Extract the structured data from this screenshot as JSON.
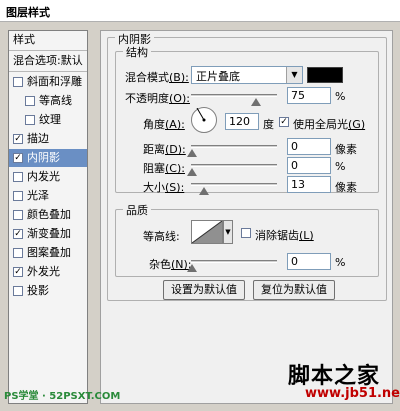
{
  "window": {
    "title": "图层样式"
  },
  "style_list": {
    "header_label": "样式",
    "blend_options_label": "混合选项:默认",
    "items": [
      {
        "label": "斜面和浮雕",
        "checked": false,
        "indent": false,
        "selected": false
      },
      {
        "label": "等高线",
        "checked": false,
        "indent": true,
        "selected": false
      },
      {
        "label": "纹理",
        "checked": false,
        "indent": true,
        "selected": false
      },
      {
        "label": "描边",
        "checked": true,
        "indent": false,
        "selected": false
      },
      {
        "label": "内阴影",
        "checked": true,
        "indent": false,
        "selected": true
      },
      {
        "label": "内发光",
        "checked": false,
        "indent": false,
        "selected": false
      },
      {
        "label": "光泽",
        "checked": false,
        "indent": false,
        "selected": false
      },
      {
        "label": "颜色叠加",
        "checked": false,
        "indent": false,
        "selected": false
      },
      {
        "label": "渐变叠加",
        "checked": true,
        "indent": false,
        "selected": false
      },
      {
        "label": "图案叠加",
        "checked": false,
        "indent": false,
        "selected": false
      },
      {
        "label": "外发光",
        "checked": true,
        "indent": false,
        "selected": false
      },
      {
        "label": "投影",
        "checked": false,
        "indent": false,
        "selected": false
      }
    ]
  },
  "inner_shadow": {
    "section_title": "内阴影",
    "structure": {
      "title": "结构",
      "blend_mode_label": "混合模式",
      "blend_mode_key": "(B):",
      "blend_mode_value": "正片叠底",
      "color": "#000000",
      "opacity_label": "不透明度",
      "opacity_key": "(O):",
      "opacity_value": "75",
      "opacity_unit": "%",
      "opacity_level": 0.75,
      "angle_label": "角度",
      "angle_key": "(A):",
      "angle_value": "120",
      "angle_unit": "度",
      "global_light_label": "使用全局光",
      "global_light_key": "(G)",
      "global_light_checked": true,
      "distance_label": "距离",
      "distance_key": "(D):",
      "distance_value": "0",
      "distance_unit": "像素",
      "choke_label": "阻塞",
      "choke_key": "(C):",
      "choke_value": "0",
      "choke_unit": "%",
      "size_label": "大小",
      "size_key": "(S):",
      "size_value": "13",
      "size_unit": "像素"
    },
    "quality": {
      "title": "品质",
      "contour_label": "等高线:",
      "anti_alias_label": "消除锯齿",
      "anti_alias_key": "(L)",
      "anti_alias_checked": false,
      "noise_label": "杂色",
      "noise_key": "(N):",
      "noise_value": "0",
      "noise_unit": "%"
    },
    "buttons": {
      "make_default": "设置为默认值",
      "reset_default": "复位为默认值"
    }
  },
  "watermarks": {
    "site_cn": "脚本之家",
    "site_url": "www.jb51.net",
    "ps_site": "PS学堂 · 52PSXT.COM"
  }
}
